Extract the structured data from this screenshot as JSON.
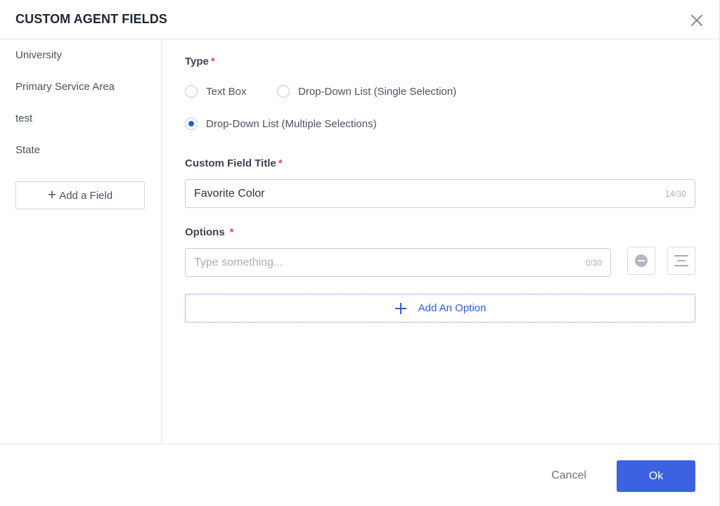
{
  "dialog": {
    "title": "CUSTOM AGENT FIELDS",
    "close_icon": "close-icon"
  },
  "sidebar": {
    "items": [
      {
        "label": "University"
      },
      {
        "label": "Primary Service Area"
      },
      {
        "label": "test"
      },
      {
        "label": "State"
      }
    ],
    "add_field_label": "Add a Field",
    "add_field_icon": "plus-icon"
  },
  "form": {
    "type_label": "Type",
    "required_mark": "*",
    "type_options": [
      {
        "label": "Text Box",
        "checked": false
      },
      {
        "label": "Drop-Down List (Single Selection)",
        "checked": false
      },
      {
        "label": "Drop-Down List (Multiple Selections)",
        "checked": true
      }
    ],
    "title_label": "Custom Field Title",
    "title_value": "Favorite Color",
    "title_counter": "14/30",
    "options_label": "Options",
    "option_placeholder": "Type something...",
    "option_counter": "0/30",
    "remove_option_icon": "minus-circle-icon",
    "drag_handle_icon": "drag-handle-icon",
    "add_option_label": "Add An Option",
    "add_option_icon": "plus-icon"
  },
  "footer": {
    "cancel_label": "Cancel",
    "ok_label": "Ok"
  },
  "colors": {
    "accent": "#3b62e0",
    "required": "#e8453c",
    "link": "#2f5bd6"
  }
}
